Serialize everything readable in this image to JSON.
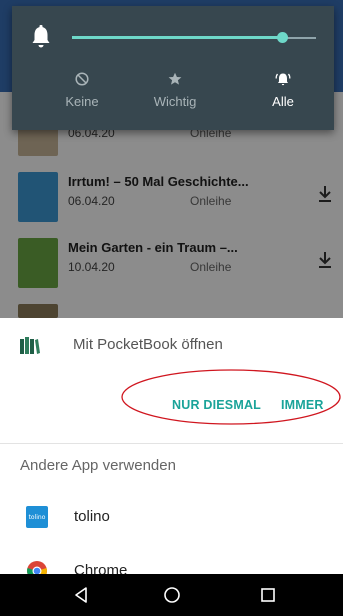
{
  "background_app": {
    "rows": [
      {
        "title": "",
        "date": "06.04.20",
        "type": "Onleihe"
      },
      {
        "title": "Irrtum! – 50 Mal Geschichte...",
        "date": "06.04.20",
        "type": "Onleihe"
      },
      {
        "title": "Mein Garten - ein Traum –...",
        "date": "10.04.20",
        "type": "Onleihe"
      }
    ]
  },
  "quick_settings": {
    "volume_level": 0.86,
    "options": [
      {
        "label": "Keine",
        "icon": "block-icon",
        "active": false
      },
      {
        "label": "Wichtig",
        "icon": "star-icon",
        "active": false
      },
      {
        "label": "Alle",
        "icon": "notifications-all-icon",
        "active": true
      }
    ]
  },
  "sheet": {
    "open_with_label": "Mit PocketBook öffnen",
    "just_once_label": "NUR DIESMAL",
    "always_label": "IMMER",
    "other_app_label": "Andere App verwenden",
    "apps": [
      {
        "name": "tolino",
        "icon_text": "tolino"
      },
      {
        "name": "Chrome"
      }
    ],
    "accent_color": "#1aa399",
    "annotation_color": "#d0161f"
  },
  "navbar": {
    "buttons": [
      "back-icon",
      "home-icon",
      "recents-icon"
    ]
  }
}
